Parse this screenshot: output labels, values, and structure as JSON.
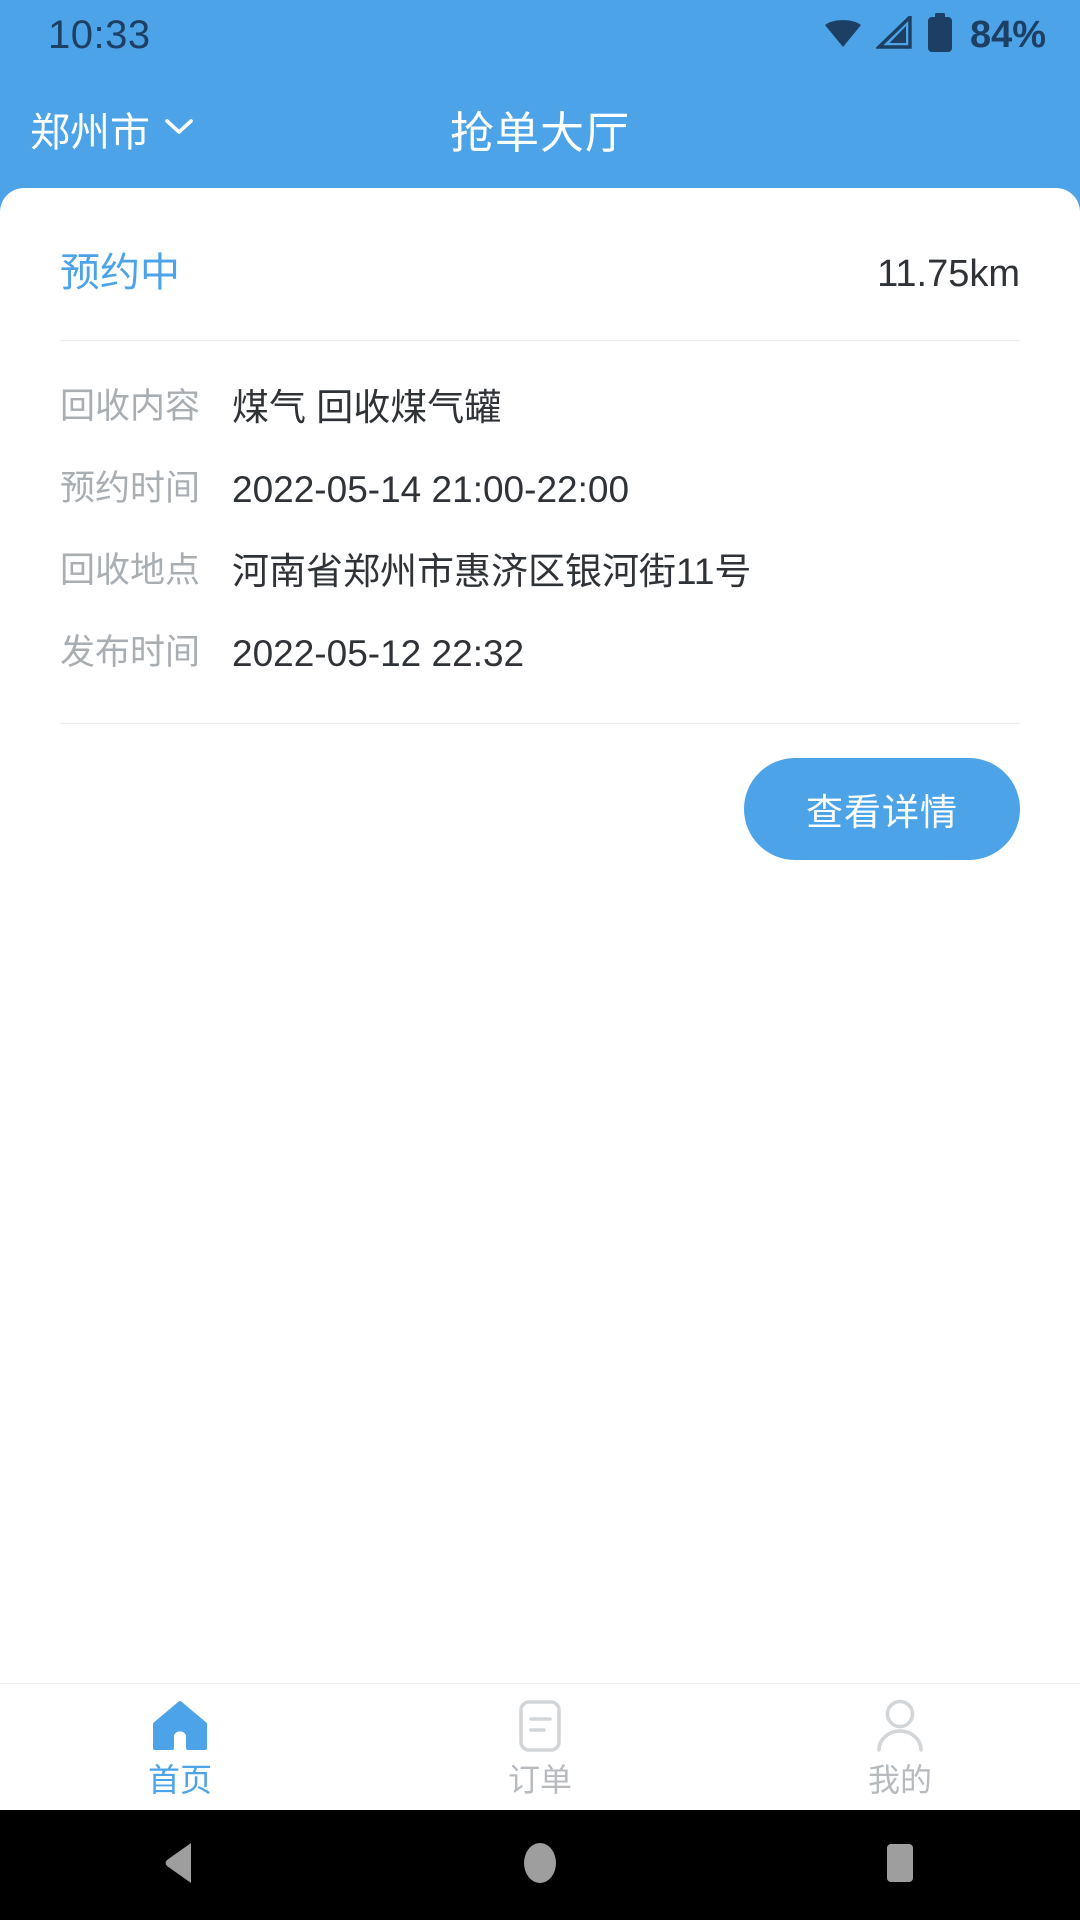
{
  "status_bar": {
    "time": "10:33",
    "battery_percent": "84%",
    "icons": [
      "wifi-icon",
      "cellular-signal-icon",
      "battery-icon"
    ]
  },
  "header": {
    "city": "郑州市",
    "city_chevron": "chevron-down-icon",
    "title": "抢单大厅"
  },
  "order_card": {
    "status": "预约中",
    "distance": "11.75km",
    "rows": [
      {
        "label": "回收内容",
        "value": "煤气  回收煤气罐"
      },
      {
        "label": "预约时间",
        "value": "2022-05-14 21:00-22:00"
      },
      {
        "label": "回收地点",
        "value": "河南省郑州市惠济区银河街11号"
      },
      {
        "label": "发布时间",
        "value": "2022-05-12 22:32"
      }
    ],
    "action_label": "查看详情"
  },
  "tab_bar": {
    "items": [
      {
        "label": "首页",
        "icon": "home-icon",
        "active": true
      },
      {
        "label": "订单",
        "icon": "order-list-icon",
        "active": false
      },
      {
        "label": "我的",
        "icon": "person-icon",
        "active": false
      }
    ]
  },
  "nav_bar": {
    "buttons": [
      {
        "name": "android-back-button",
        "icon": "triangle-back-icon"
      },
      {
        "name": "android-home-button",
        "icon": "circle-home-icon"
      },
      {
        "name": "android-recents-button",
        "icon": "square-recents-icon"
      }
    ]
  },
  "colors": {
    "brand_blue": "#4da3e8",
    "status_icon_navy": "#1c3f63",
    "label_gray": "#a9aeb3",
    "value_dark": "#2f3338",
    "tab_inactive": "#b7bbbf",
    "divider": "#ececec",
    "nav_bar_bg": "#000000",
    "nav_icon_gray": "#9e9e9e"
  }
}
